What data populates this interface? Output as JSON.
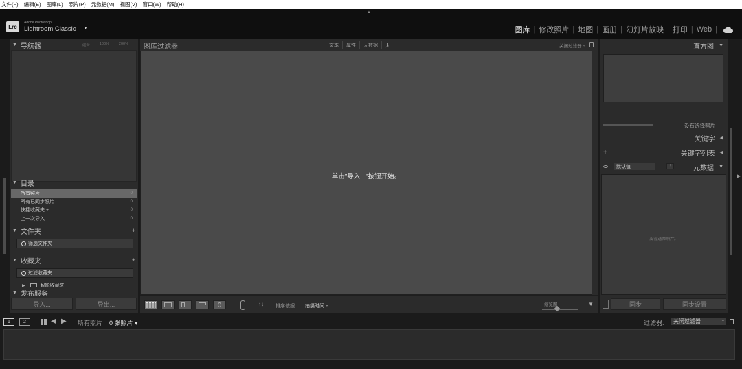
{
  "menu": [
    "文件(F)",
    "编辑(E)",
    "图库(L)",
    "照片(P)",
    "元数据(M)",
    "视图(V)",
    "窗口(W)",
    "帮助(H)"
  ],
  "brand": {
    "logo": "Lrc",
    "small": "Adobe Photoshop",
    "big": "Lightroom Classic",
    "caret": "▼"
  },
  "modules": {
    "library": "图库",
    "develop": "修改照片",
    "map": "地图",
    "book": "画册",
    "slideshow": "幻灯片放映",
    "print": "打印",
    "web": "Web",
    "separator": "|"
  },
  "left": {
    "navigator": {
      "title": "导航器",
      "zoom": [
        "适合",
        "100%",
        "200%"
      ]
    },
    "catalog": {
      "title": "目录",
      "rows": [
        {
          "label": "所有照片",
          "count": "0"
        },
        {
          "label": "所有已同步照片",
          "count": "0"
        },
        {
          "label": "快捷收藏夹 +",
          "count": "0"
        },
        {
          "label": "上一次导入",
          "count": "0"
        }
      ]
    },
    "folders": {
      "title": "文件夹",
      "plus": "+",
      "filter": "筛选文件夹"
    },
    "collections": {
      "title": "收藏夹",
      "plus": "+",
      "filter": "过滤收藏夹",
      "smart": "智能收藏夹"
    },
    "publish": {
      "title": "发布服务"
    },
    "import_label": "导入...",
    "export_label": "导出..."
  },
  "center": {
    "filter_title": "图库过滤器",
    "filter_tabs": [
      "文本",
      "属性",
      "元数据",
      "无"
    ],
    "close_filter": "关闭过滤器 ÷",
    "empty_message": "单击\"导入...\"按钮开始。",
    "toolbar": {
      "sort_label": "排序依据",
      "sort_value": "拍摄时间 ÷",
      "thumb_label": "缩览图",
      "dropdown": "▼"
    }
  },
  "right": {
    "histogram": {
      "title": "直方图",
      "sub": "没有选择照片"
    },
    "keywords": {
      "title": "关键字"
    },
    "keyword_list": {
      "title": "关键字列表",
      "plus": "+"
    },
    "metadata": {
      "title": "元数据",
      "preset": "默认值",
      "empty": "没有选择照片。"
    },
    "sync_label": "同步",
    "sync_settings_label": "同步设置"
  },
  "filmstrip": {
    "page1": "1",
    "page2": "2",
    "source": "所有照片",
    "count": "0 张照片 ▾",
    "filter_label": "过滤器:",
    "filter_value": "关闭过滤器"
  },
  "colors": {
    "background": "#1b1b1b",
    "panel": "#2b2b2b",
    "grid": "#4a4a4a",
    "selected_row": "#686868"
  }
}
